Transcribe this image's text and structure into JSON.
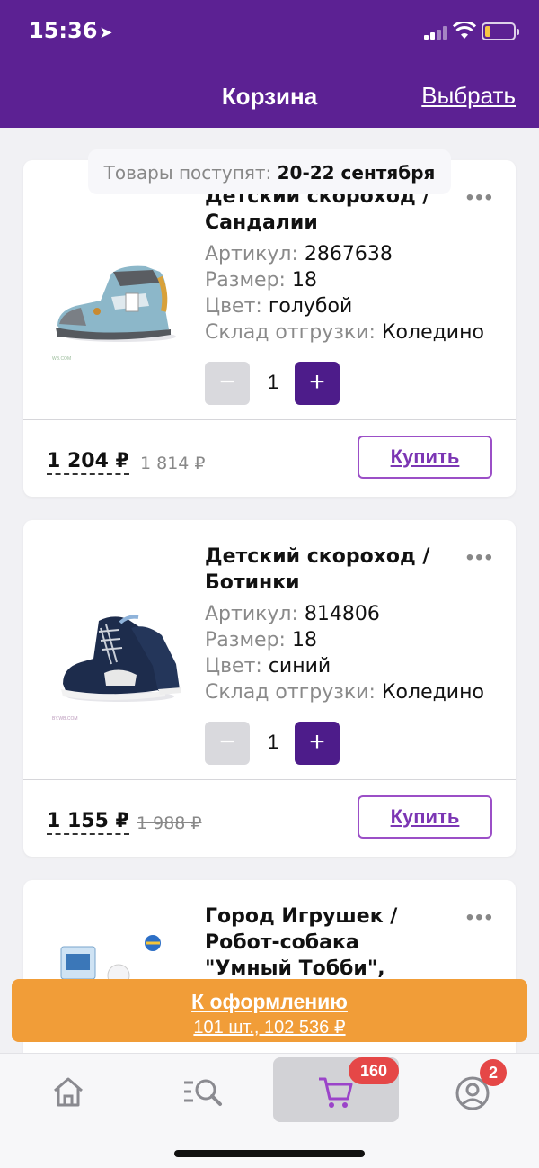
{
  "status_bar": {
    "time": "15:36"
  },
  "header": {
    "title": "Корзина",
    "action_label": "Выбрать"
  },
  "delivery": {
    "label": "Товары поступят:",
    "dates": "20-22 сентября"
  },
  "items": [
    {
      "title": "Детский скороход / Сандалии",
      "attrs": [
        {
          "key": "Артикул:",
          "value": "2867638"
        },
        {
          "key": "Размер:",
          "value": "18"
        },
        {
          "key": "Цвет:",
          "value": "голубой"
        },
        {
          "key": "Склад отгрузки:",
          "value": "Коледино"
        }
      ],
      "qty": "1",
      "price": "1 204 ₽",
      "old_price": "1 814 ₽",
      "buy_label": "Купить"
    },
    {
      "title": "Детский скороход / Ботинки",
      "attrs": [
        {
          "key": "Артикул:",
          "value": "814806"
        },
        {
          "key": "Размер:",
          "value": "18"
        },
        {
          "key": "Цвет:",
          "value": "синий"
        },
        {
          "key": "Склад отгрузки:",
          "value": "Коледино"
        }
      ],
      "qty": "1",
      "price": "1 155 ₽",
      "old_price": "1 988 ₽",
      "buy_label": "Купить"
    },
    {
      "title": "Город Игрушек / Робот-собака \"Умный Тобби\", голубой"
    }
  ],
  "checkout": {
    "label": "К оформлению",
    "summary": "101 шт., 102 536 ₽"
  },
  "tabbar": {
    "items": [
      {
        "name": "home",
        "icon": "home-icon"
      },
      {
        "name": "catalog",
        "icon": "search-list-icon"
      },
      {
        "name": "cart",
        "icon": "cart-icon",
        "badge": "160"
      },
      {
        "name": "profile",
        "icon": "profile-icon",
        "badge": "2"
      }
    ]
  },
  "colors": {
    "brand": "#5c2193",
    "accent": "#f19d38",
    "badge": "#e54747"
  }
}
